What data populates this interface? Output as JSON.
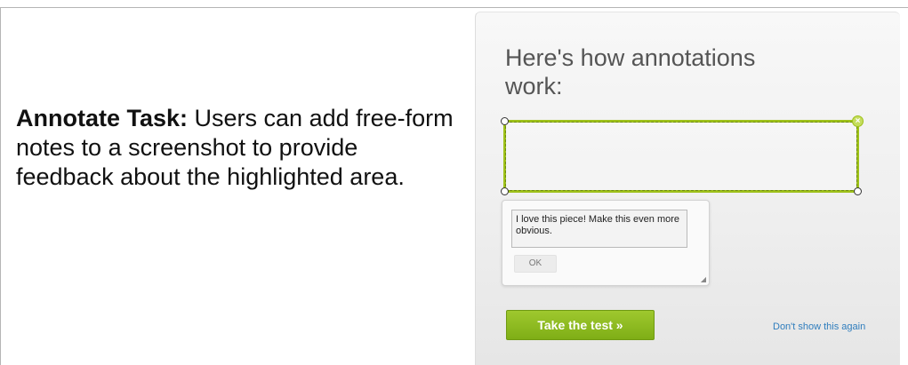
{
  "description": {
    "bold_label": "Annotate Task:",
    "body": " Users can add free-form notes to a screenshot to provide feedback about the highlighted area."
  },
  "panel": {
    "heading": "Here's how annotations work:",
    "close_icon_glyph": "×",
    "note_text": "I love this piece! Make this even more obvious.",
    "ok_label": "OK",
    "take_test_label": "Take the test »",
    "dont_show_label": "Don't show this again"
  },
  "colors": {
    "accent_green": "#9ec11a",
    "button_green": "#7fae16",
    "link_blue": "#2f7dbd"
  }
}
